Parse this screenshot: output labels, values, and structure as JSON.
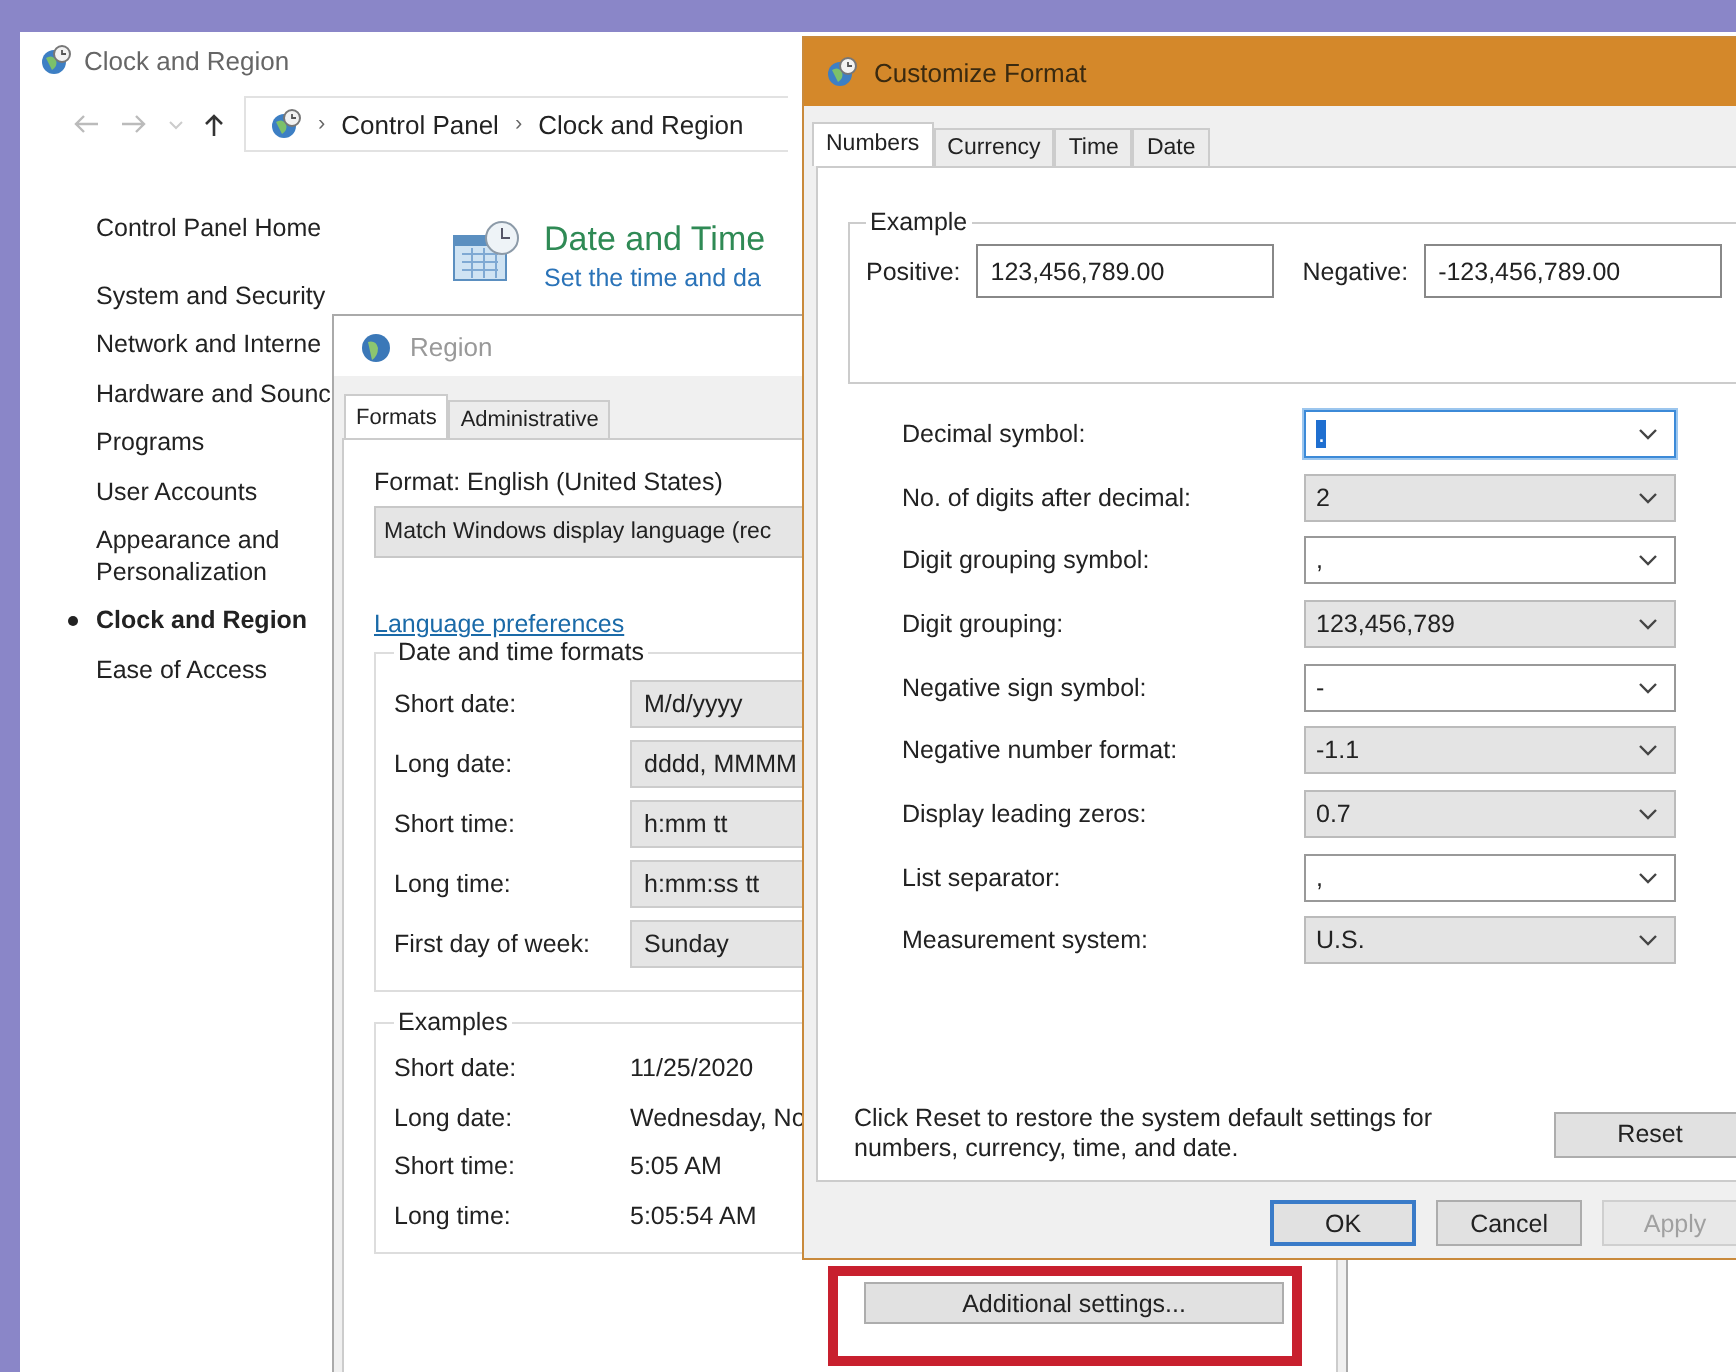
{
  "control_panel": {
    "title": "Clock and Region",
    "breadcrumb": [
      {
        "separator": "›",
        "label": "Control Panel"
      },
      {
        "separator": "›",
        "label": "Clock and Region"
      }
    ],
    "home_link": "Control Panel Home",
    "sidebar": {
      "items": [
        {
          "label": "System and Security",
          "selected": false
        },
        {
          "label": "Network and Interne",
          "selected": false
        },
        {
          "label": "Hardware and Sounc",
          "selected": false
        },
        {
          "label": "Programs",
          "selected": false
        },
        {
          "label": "User Accounts",
          "selected": false
        },
        {
          "label": "Appearance and Personalization",
          "selected": false
        },
        {
          "label": "Clock and Region",
          "selected": true
        },
        {
          "label": "Ease of Access",
          "selected": false
        }
      ]
    },
    "category": {
      "title": "Date and Time",
      "link": "Set the time and da"
    }
  },
  "region_dialog": {
    "title": "Region",
    "tabs": [
      {
        "label": "Formats",
        "selected": true
      },
      {
        "label": "Administrative",
        "selected": false
      }
    ],
    "format_label": "Format: English (United States)",
    "format_value": "Match Windows display language (rec",
    "language_link": "Language preferences",
    "formats_group": {
      "title": "Date and time formats",
      "rows": [
        {
          "label": "Short date:",
          "value": "M/d/yyyy"
        },
        {
          "label": "Long date:",
          "value": "dddd, MMMM"
        },
        {
          "label": "Short time:",
          "value": "h:mm tt"
        },
        {
          "label": "Long time:",
          "value": "h:mm:ss tt"
        },
        {
          "label": "First day of week:",
          "value": "Sunday"
        }
      ]
    },
    "examples_group": {
      "title": "Examples",
      "rows": [
        {
          "label": "Short date:",
          "value": "11/25/2020"
        },
        {
          "label": "Long date:",
          "value": "Wednesday, No"
        },
        {
          "label": "Short time:",
          "value": "5:05 AM"
        },
        {
          "label": "Long time:",
          "value": "5:05:54 AM"
        }
      ]
    },
    "additional_button": {
      "label": "Additional settings...",
      "highlighted": true
    }
  },
  "customize_dialog": {
    "title": "Customize Format",
    "tabs": [
      {
        "label": "Numbers",
        "selected": true
      },
      {
        "label": "Currency",
        "selected": false
      },
      {
        "label": "Time",
        "selected": false
      },
      {
        "label": "Date",
        "selected": false
      }
    ],
    "example": {
      "title": "Example",
      "positive_label": "Positive:",
      "positive_value": "123,456,789.00",
      "negative_label": "Negative:",
      "negative_value": "-123,456,789.00"
    },
    "settings": [
      {
        "label": "Decimal symbol:",
        "value": ".",
        "kind": "editable",
        "focused": true
      },
      {
        "label": "No. of digits after decimal:",
        "value": "2",
        "kind": "list",
        "focused": false
      },
      {
        "label": "Digit grouping symbol:",
        "value": ",",
        "kind": "editable",
        "focused": false
      },
      {
        "label": "Digit grouping:",
        "value": "123,456,789",
        "kind": "list",
        "focused": false
      },
      {
        "label": "Negative sign symbol:",
        "value": "-",
        "kind": "editable",
        "focused": false
      },
      {
        "label": "Negative number format:",
        "value": "-1.1",
        "kind": "list",
        "focused": false
      },
      {
        "label": "Display leading zeros:",
        "value": "0.7",
        "kind": "list",
        "focused": false
      },
      {
        "label": "List separator:",
        "value": ",",
        "kind": "editable",
        "focused": false
      },
      {
        "label": "Measurement system:",
        "value": "U.S.",
        "kind": "list",
        "focused": false
      }
    ],
    "reset_note": "Click Reset to restore the system default settings for numbers, currency, time, and date.",
    "reset_button": "Reset",
    "footer_buttons": [
      {
        "label": "OK",
        "default": true,
        "disabled": false
      },
      {
        "label": "Cancel",
        "default": false,
        "disabled": false
      },
      {
        "label": "Apply",
        "default": false,
        "disabled": true
      }
    ]
  }
}
